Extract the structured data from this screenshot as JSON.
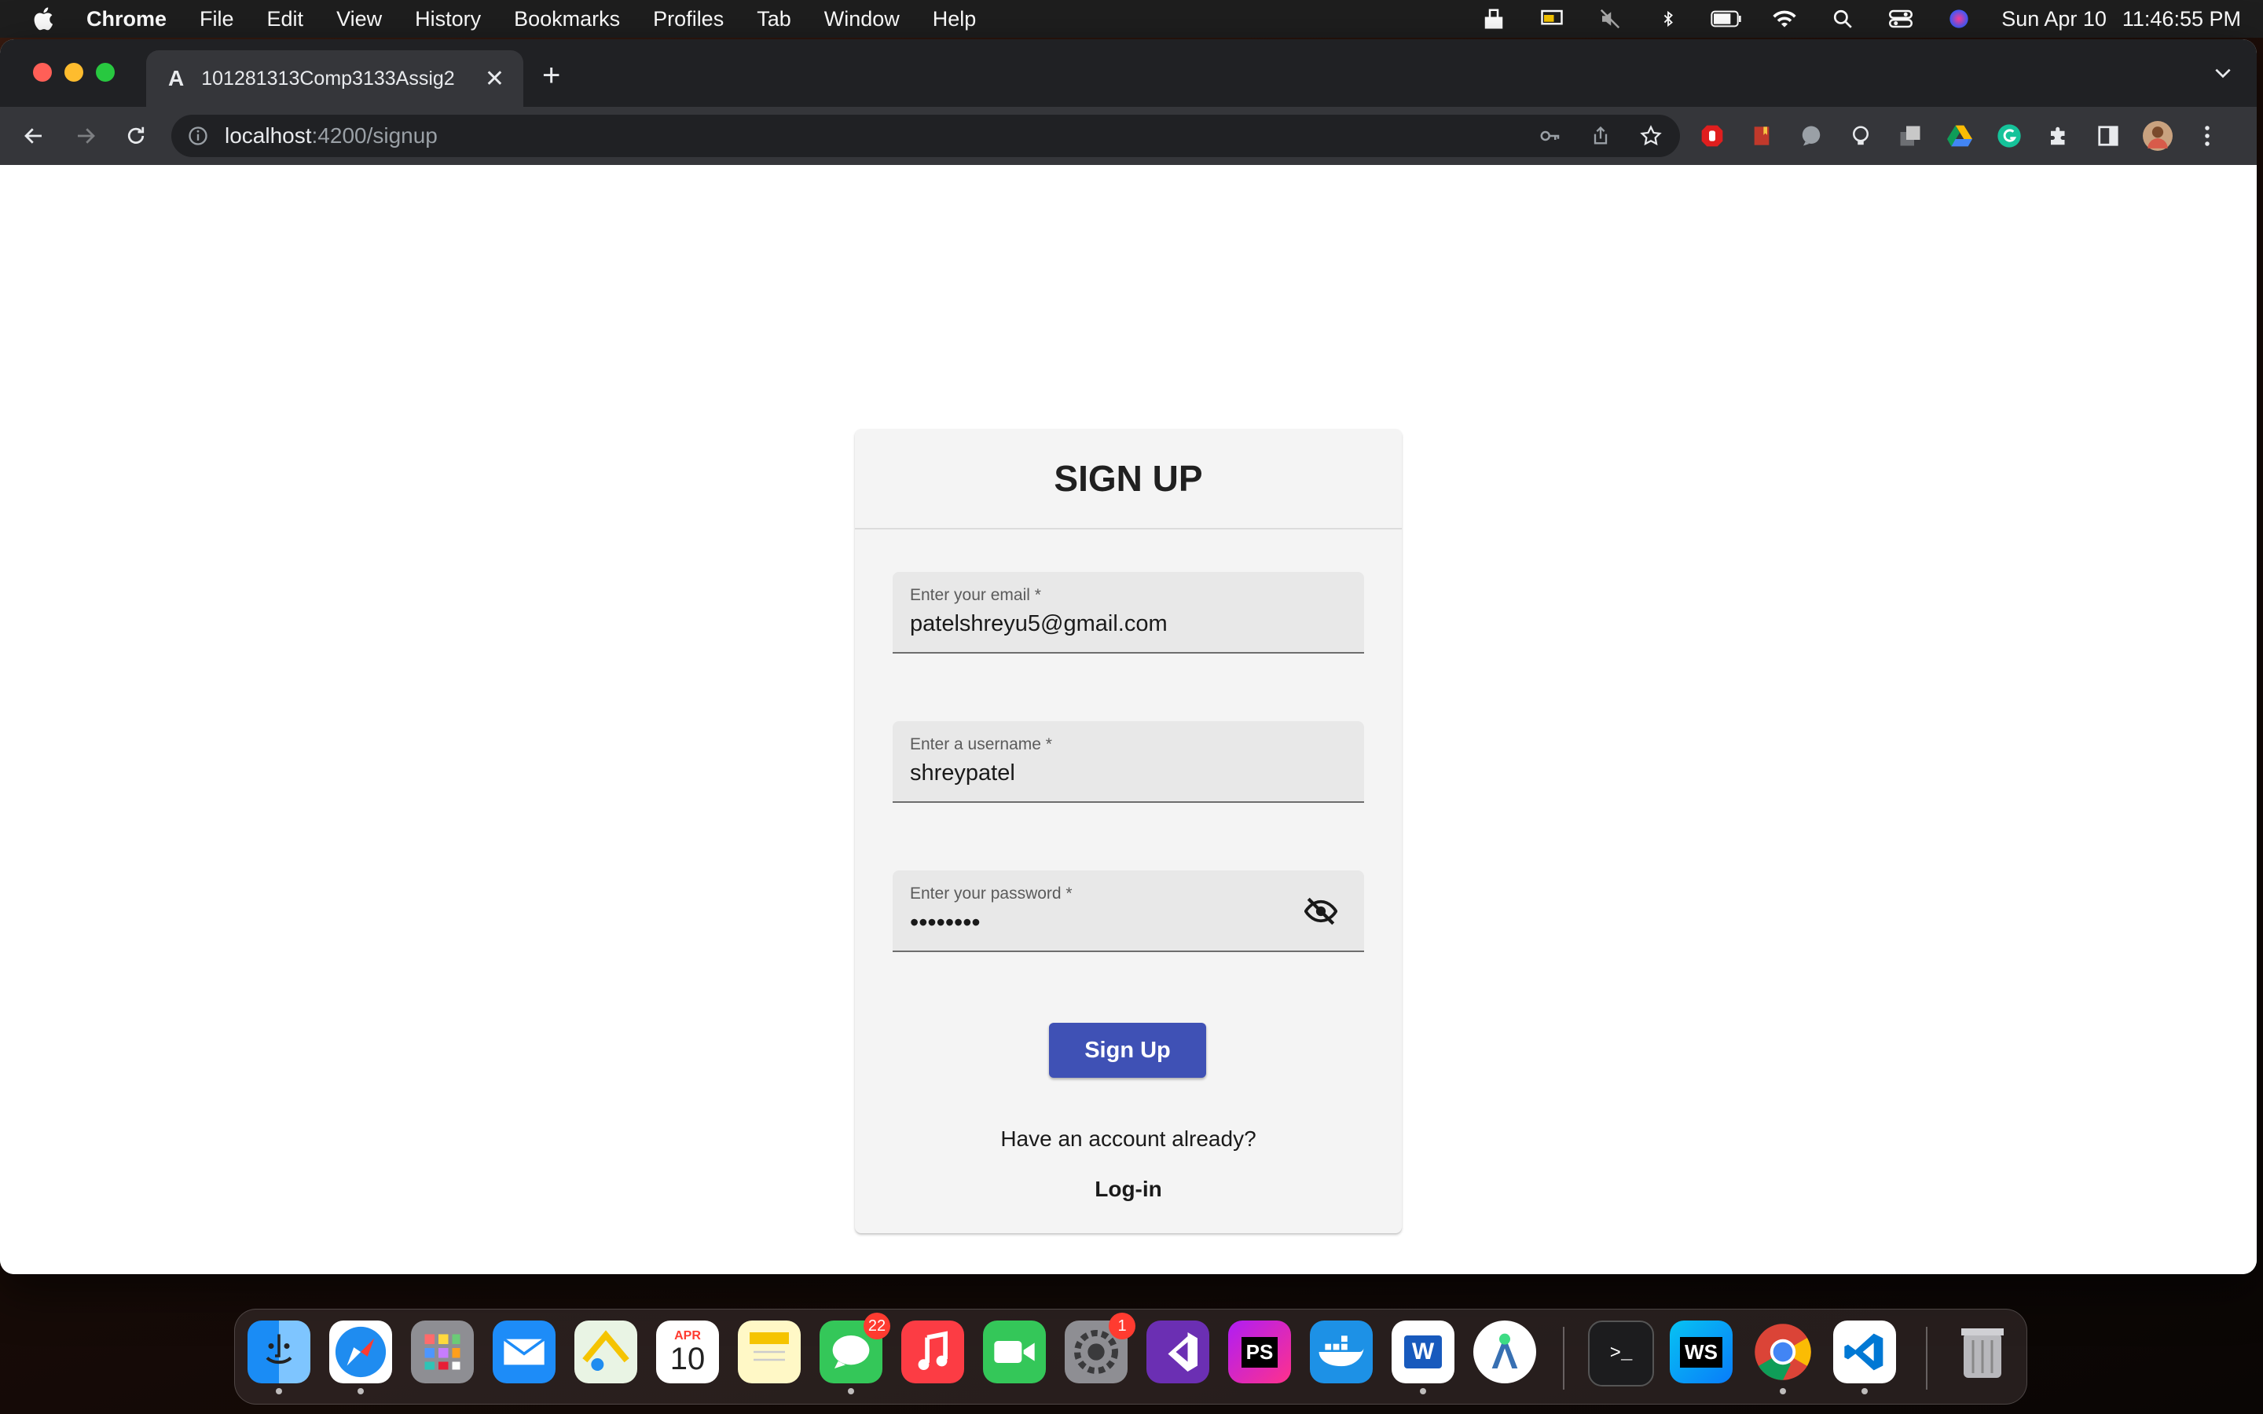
{
  "menubar": {
    "app_name": "Chrome",
    "items": [
      "File",
      "Edit",
      "View",
      "History",
      "Bookmarks",
      "Profiles",
      "Tab",
      "Window",
      "Help"
    ],
    "date": "Sun Apr 10",
    "time": "11:46:55 PM"
  },
  "browser": {
    "tab_title": "101281313Comp3133Assig2",
    "tab_favicon": "A",
    "url_host": "localhost",
    "url_rest": ":4200/signup"
  },
  "form": {
    "title": "SIGN UP",
    "email_label": "Enter your email *",
    "email_value": "patelshreyu5@gmail.com",
    "username_label": "Enter a username *",
    "username_value": "shreypatel",
    "password_label": "Enter your password *",
    "password_value": "••••••••",
    "submit_label": "Sign Up",
    "have_account_text": "Have an account already?",
    "login_label": "Log-in"
  },
  "dock": {
    "calendar_month": "APR",
    "calendar_day": "10",
    "messages_badge": "22",
    "settings_badge": "1",
    "phpstorm_label": "PS",
    "webstorm_label": "WS"
  },
  "colors": {
    "primary_button": "#3f51b5",
    "card_background": "#f4f4f4",
    "field_background": "#e8e8e8"
  }
}
